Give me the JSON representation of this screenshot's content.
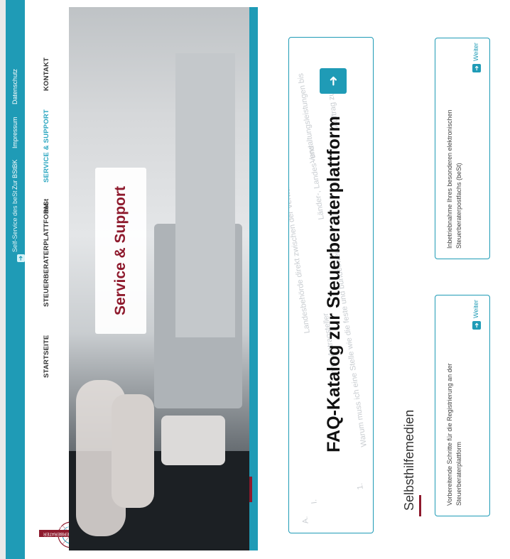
{
  "topbar": {
    "selfservice_label": "Self-Service des beSt",
    "bstbk_label": "Zur BStBK",
    "impressum_label": "Impressum",
    "datenschutz_label": "Datenschutz"
  },
  "logo": {
    "text": "STEUERBERATER PLATTFORM"
  },
  "nav": {
    "items": [
      "STARTSEITE",
      "STEUERBERATERPLATTFORM",
      "beSt",
      "SERVICE & SUPPORT",
      "KONTAKT"
    ]
  },
  "hero": {
    "title": "Service & Support"
  },
  "faq": {
    "title": "FAQ-Katalog zur Steuerberaterplattform",
    "bg_lines": [
      "A.",
      "I.",
      "1.",
      "Warum muss ich eine Stelle wie die feste und bundesweit",
      "Landesbehörde direkt zwischen der Verwaltung meist",
      "Länder-, Landes- und",
      "Verwaltungsleistungen bis",
      "Auftrag zu",
      "Ihren Antragsteller"
    ]
  },
  "selbsthilfe": {
    "title": "Selbsthilfemedien",
    "cards": [
      {
        "text": "Vorbereitende Schritte für die Registrierung an der Steuerberaterplattform",
        "link": "Weiter"
      },
      {
        "text": "Inbetriebnahme Ihres besonderen elektronischen Steuerberaterpostfachs (beSt)",
        "link": "Weiter"
      }
    ]
  },
  "colors": {
    "teal": "#1f9bb6",
    "maroon": "#8e1a2d"
  }
}
